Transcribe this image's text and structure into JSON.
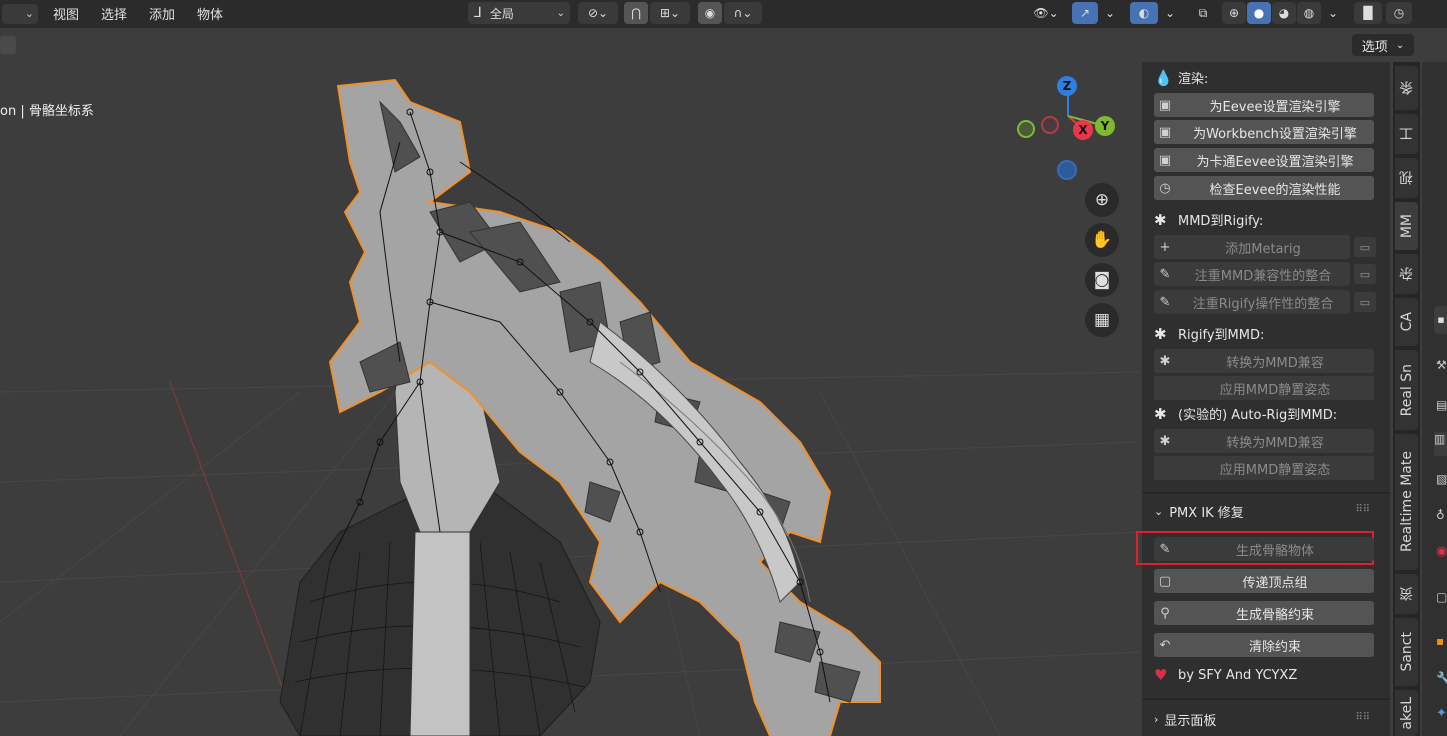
{
  "header": {
    "menus": [
      "视图",
      "选择",
      "添加",
      "物体"
    ],
    "transform_orientation": "全局",
    "options_label": "选项"
  },
  "viewport": {
    "overlay_text": "on | 骨骼坐标系",
    "gizmo": {
      "z": "Z",
      "x": "X",
      "y": "Y"
    }
  },
  "panel": {
    "render_heading": "渲染:",
    "render_buttons": [
      {
        "label": "为Eevee设置渲染引擎",
        "icon": "render-icon"
      },
      {
        "label": "为Workbench设置渲染引擎",
        "icon": "render-icon"
      },
      {
        "label": "为卡通Eevee设置渲染引擎",
        "icon": "render-icon"
      },
      {
        "label": "检查Eevee的渲染性能",
        "icon": "clock-icon"
      }
    ],
    "mmd_to_rigify_heading": "MMD到Rigify:",
    "mmd_to_rigify_buttons": [
      {
        "label": "添加Metarig",
        "enabled": false
      },
      {
        "label": "注重MMD兼容性的整合",
        "enabled": false
      },
      {
        "label": "注重Rigify操作性的整合",
        "enabled": false
      }
    ],
    "rigify_to_mmd_heading": "Rigify到MMD:",
    "rigify_to_mmd_buttons": [
      {
        "label": "转换为MMD兼容",
        "enabled": false
      },
      {
        "label": "应用MMD静置姿态",
        "enabled": false
      }
    ],
    "autorig_heading": "(实验的) Auto-Rig到MMD:",
    "autorig_buttons": [
      {
        "label": "转换为MMD兼容",
        "enabled": false
      },
      {
        "label": "应用MMD静置姿态",
        "enabled": false
      }
    ],
    "pmx_section_title": "PMX IK 修复",
    "pmx_buttons": [
      {
        "label": "生成骨骼物体",
        "enabled": false,
        "highlighted": true
      },
      {
        "label": "传递顶点组",
        "enabled": true
      },
      {
        "label": "生成骨骼约束",
        "enabled": true
      },
      {
        "label": "清除约束",
        "enabled": true
      }
    ],
    "credit": "by SFY And YCYXZ",
    "display_panel_title": "显示面板"
  },
  "tabs": [
    "条",
    "工",
    "视",
    "MM",
    "杂",
    "CA",
    "Real Sn",
    "Realtime Mate",
    "资",
    "Sanct",
    "akeL"
  ],
  "colors": {
    "highlight_border": "#e0202a",
    "accent_blue": "#4772b3",
    "selection_orange": "#f0902a",
    "gizmo_x": "#e8364d",
    "gizmo_y": "#7dba2f",
    "gizmo_z": "#2f7fe0"
  }
}
